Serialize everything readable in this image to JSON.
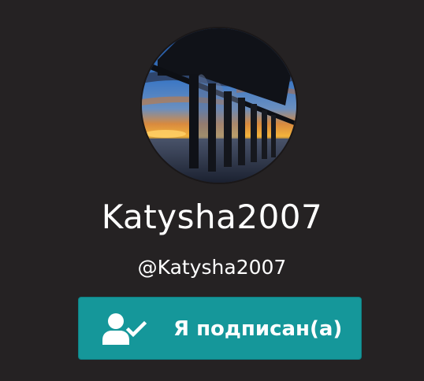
{
  "profile": {
    "display_name": "Katysha2007",
    "username": "@Katysha2007",
    "avatar_icon": "avatar-photo"
  },
  "subscribe_button": {
    "label": "Я подписан(а)",
    "icon": "user-check-icon",
    "color": "#15979a"
  },
  "theme": {
    "background": "#252223",
    "text": "#ffffff"
  }
}
